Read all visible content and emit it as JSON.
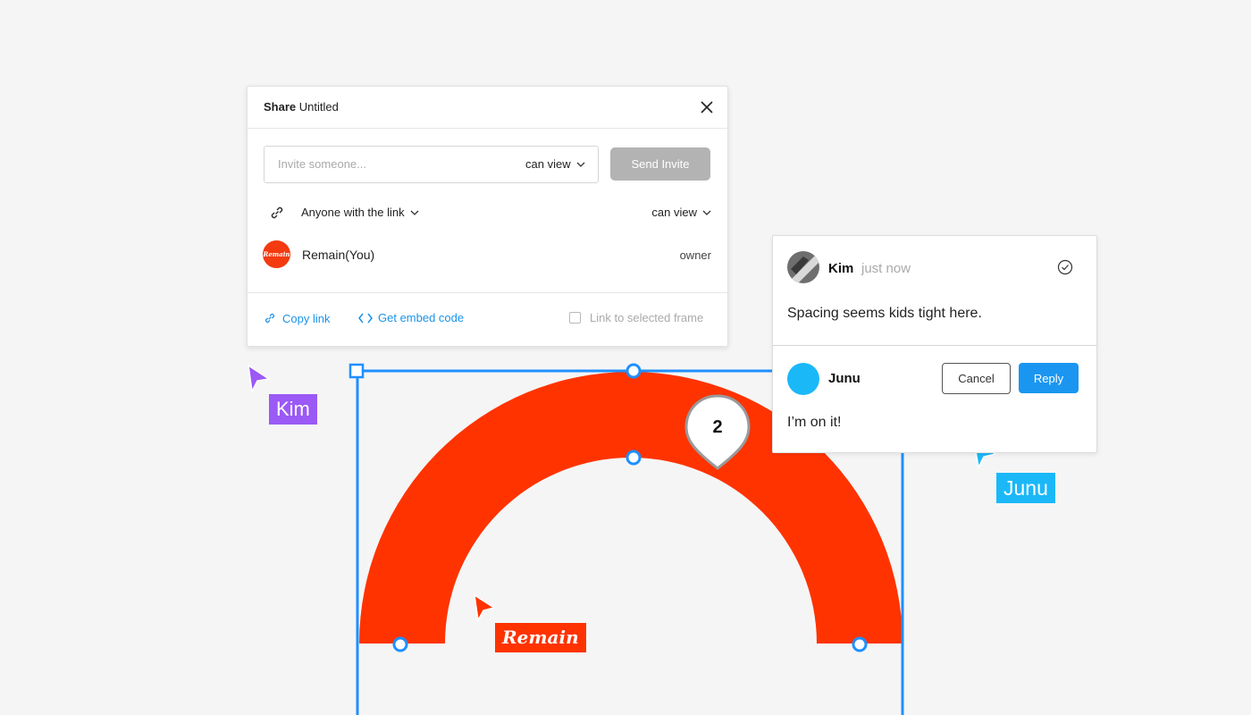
{
  "share": {
    "title_bold": "Share",
    "title_rest": "Untitled",
    "invite_placeholder": "Invite someone...",
    "invite_permission": "can view",
    "send_label": "Send Invite",
    "link_scope": "Anyone with the link",
    "link_permission": "can view",
    "owner_avatar_text": "Remain",
    "owner_name": "Remain(You)",
    "owner_role": "owner",
    "copy_link": "Copy link",
    "embed_code": "Get embed code",
    "link_frame": "Link to selected frame"
  },
  "cursors": {
    "kim": "Kim",
    "junu": "Junu",
    "remain": "Remain"
  },
  "pin": {
    "number": "2"
  },
  "comment": {
    "author": "Kim",
    "time": "just now",
    "text": "Spacing seems kids tight here.",
    "reply_author": "Junu",
    "cancel_label": "Cancel",
    "reply_label": "Reply",
    "reply_text": "I’m on it!"
  },
  "colors": {
    "shape": "#ff3300",
    "selection": "#1e90ff",
    "kim": "#9b59f5",
    "junu": "#1bb8f8",
    "remain": "#ff3300"
  }
}
